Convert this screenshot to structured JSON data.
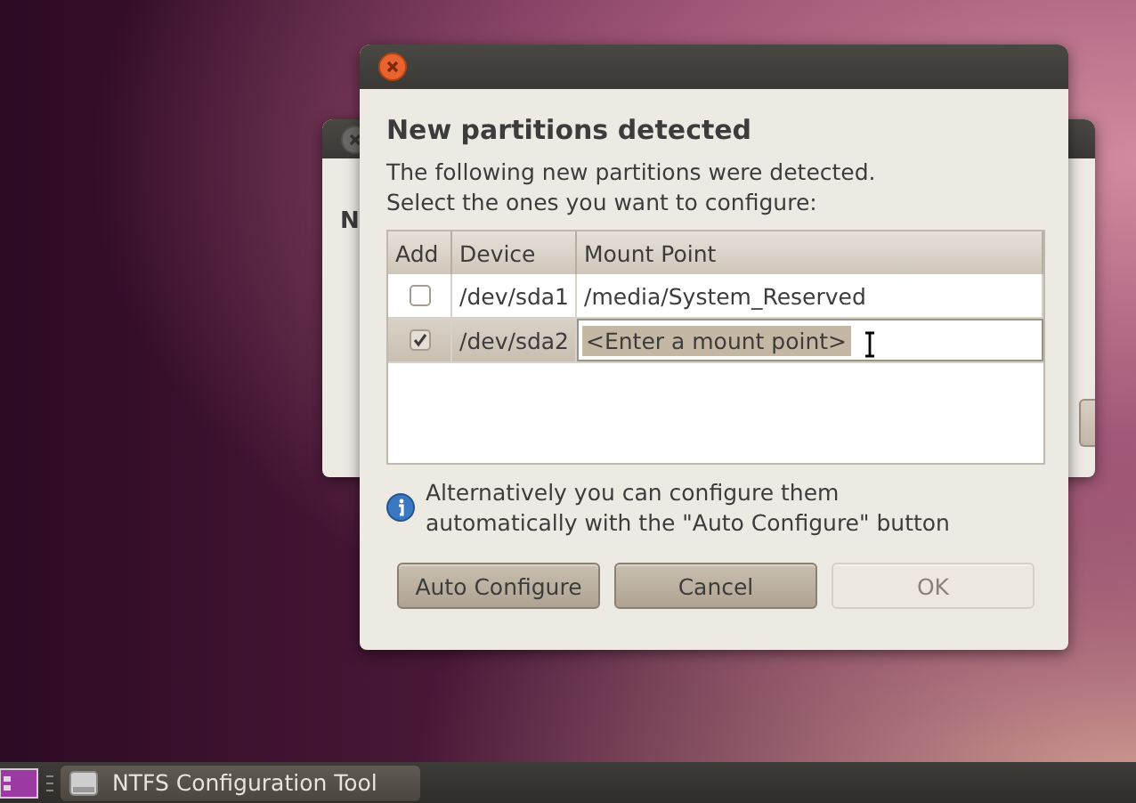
{
  "back_window": {
    "heading": "N"
  },
  "dialog": {
    "heading": "New partitions detected",
    "description": [
      "The following new partitions were detected.",
      "Select the ones you want to configure:"
    ],
    "table": {
      "columns": [
        "Add",
        "Device",
        "Mount Point"
      ],
      "rows": [
        {
          "checked": false,
          "device": "/dev/sda1",
          "mount_point": "/media/System_Reserved",
          "selected": false,
          "editing": false
        },
        {
          "checked": true,
          "device": "/dev/sda2",
          "mount_point": "<Enter a mount point>",
          "selected": true,
          "editing": true
        }
      ]
    },
    "info": [
      "Alternatively you can configure them",
      "automatically with the \"Auto Configure\" button"
    ],
    "buttons": [
      {
        "label": "Auto Configure",
        "disabled": false
      },
      {
        "label": "Cancel",
        "disabled": false
      },
      {
        "label": "OK",
        "disabled": true
      }
    ]
  },
  "taskbar": {
    "window_button": "NTFS Configuration Tool"
  }
}
